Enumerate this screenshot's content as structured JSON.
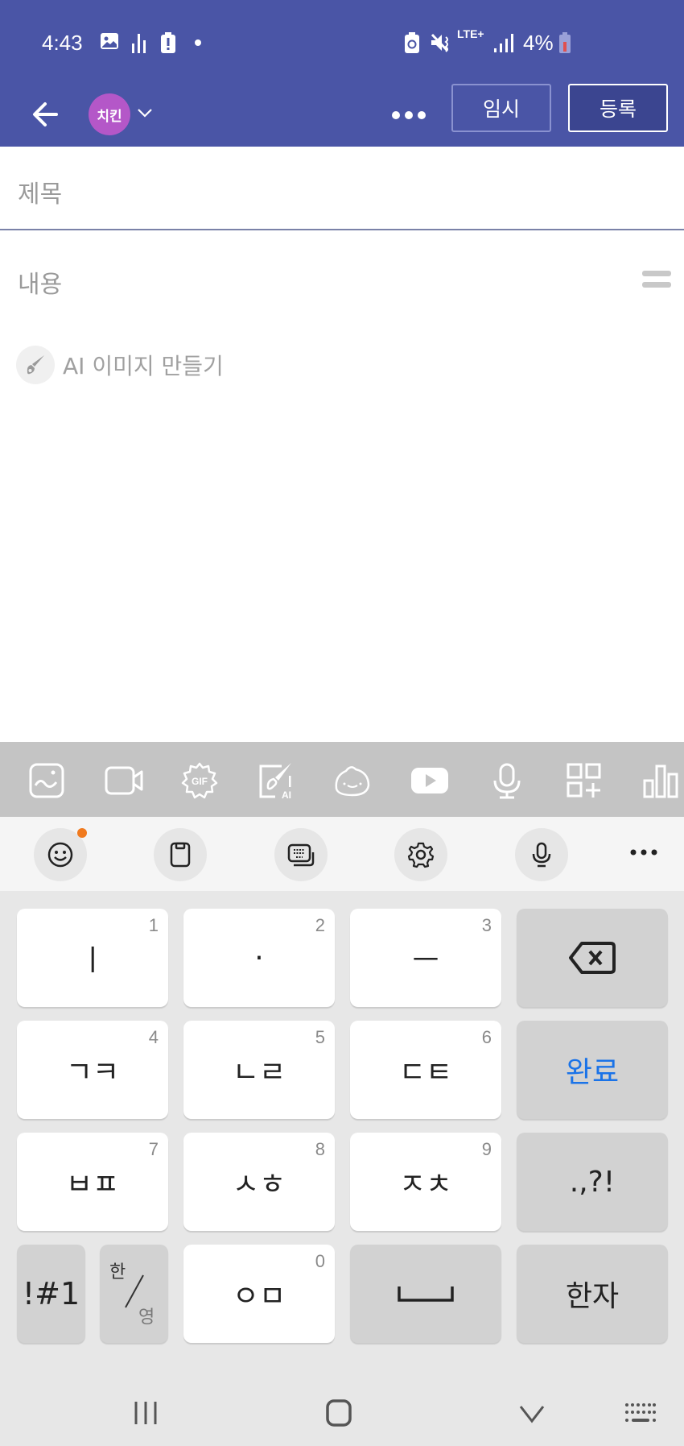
{
  "status_bar": {
    "time": "4:43",
    "left_icons": [
      "gallery-icon",
      "signal-bars-icon",
      "battery-alert-icon",
      "dot-icon"
    ],
    "right_icons": [
      "battery-saver-icon",
      "vibrate-mute-icon",
      "lte-plus-icon",
      "cell-signal-icon"
    ],
    "network": "LTE+",
    "battery_percent": "4%"
  },
  "app_bar": {
    "board_chip": "치킨",
    "more_icon": "more-horizontal-icon",
    "temp_save_label": "임시",
    "post_label": "등록"
  },
  "editor": {
    "title_placeholder": "제목",
    "content_placeholder": "내용",
    "ai_image_label": "AI 이미지 만들기"
  },
  "attach_toolbar": {
    "items": [
      "image",
      "video",
      "gif",
      "ai-drawing",
      "sticker",
      "youtube",
      "voice",
      "add-widget",
      "poll"
    ]
  },
  "keyboard": {
    "top_tools": [
      "emoji",
      "clipboard",
      "keyboard-mode",
      "settings",
      "voice-input",
      "more"
    ],
    "rows": [
      [
        {
          "label": "ㅣ",
          "num": "1"
        },
        {
          "label": "·",
          "num": "2"
        },
        {
          "label": "ㅡ",
          "num": "3"
        },
        {
          "label": "backspace"
        }
      ],
      [
        {
          "label": "ㄱㅋ",
          "num": "4"
        },
        {
          "label": "ㄴㄹ",
          "num": "5"
        },
        {
          "label": "ㄷㅌ",
          "num": "6"
        },
        {
          "label": "완료"
        }
      ],
      [
        {
          "label": "ㅂㅍ",
          "num": "7"
        },
        {
          "label": "ㅅㅎ",
          "num": "8"
        },
        {
          "label": "ㅈㅊ",
          "num": "9"
        },
        {
          "label": ".,?!"
        }
      ],
      [
        {
          "label": "!#1"
        },
        {
          "label_top": "한",
          "label_bottom": "영"
        },
        {
          "label": "ㅇㅁ",
          "num": "0"
        },
        {
          "label": "space"
        },
        {
          "label": "한자"
        }
      ]
    ],
    "done_color": "#1a73e8"
  },
  "nav_bar": {
    "items": [
      "recent-apps",
      "home",
      "hide-keyboard",
      "keyboard-switch"
    ]
  }
}
